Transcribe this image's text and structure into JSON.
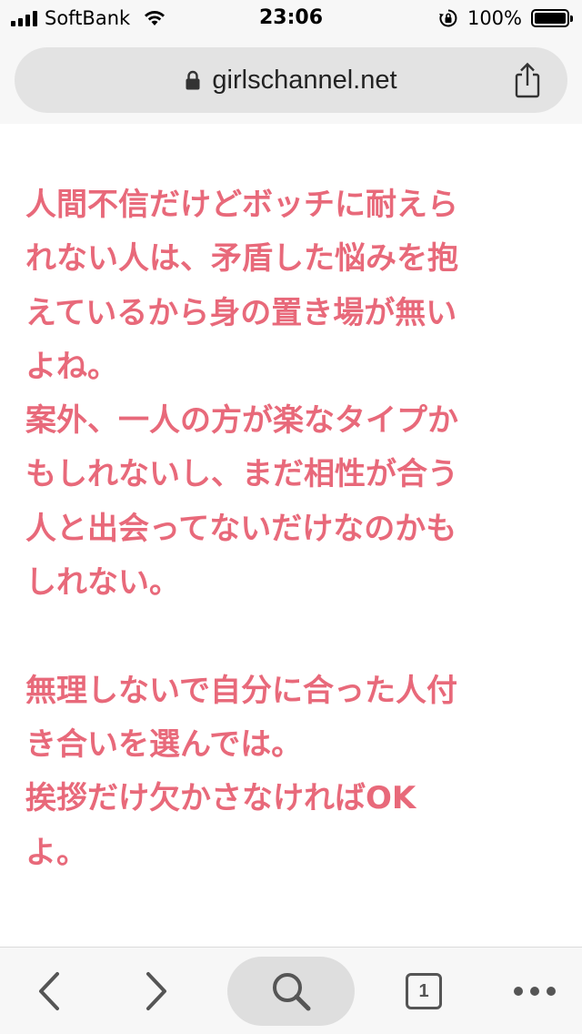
{
  "status_bar": {
    "carrier": "SoftBank",
    "time": "23:06",
    "battery_percent": "100%",
    "icons": [
      "signal-icon",
      "wifi-icon",
      "orientation-lock-icon",
      "battery-icon"
    ]
  },
  "address_bar": {
    "url": "girlschannel.net",
    "icons": [
      "lock-icon",
      "share-icon"
    ]
  },
  "comment": {
    "color": "#e8697a",
    "lines": [
      "人間不信だけどボッチに耐えら",
      "れない人は、矛盾した悩みを抱",
      "えているから身の置き場が無い",
      "よね。",
      "案外、一人の方が楽なタイプか",
      "もしれないし、まだ相性が合う",
      "人と出会ってないだけなのかも",
      "しれない。",
      "",
      "無理しないで自分に合った人付",
      "き合いを選んでは。",
      "挨拶だけ欠かさなければOK",
      "よ。"
    ]
  },
  "toolbar": {
    "tab_count": "1",
    "icons": [
      "back-icon",
      "forward-icon",
      "search-icon",
      "tabs-icon",
      "more-icon"
    ]
  }
}
